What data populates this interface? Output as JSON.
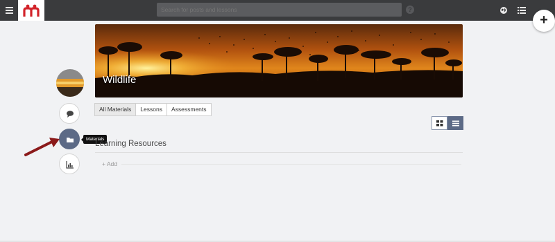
{
  "topbar": {
    "search_placeholder": "Search for posts and lessons",
    "help_label": "?",
    "plus_label": "+"
  },
  "banner": {
    "title": "Wildlife"
  },
  "tooltip": {
    "text": "Materials"
  },
  "tabs": [
    {
      "label": "All Materials",
      "active": true
    },
    {
      "label": "Lessons",
      "active": false
    },
    {
      "label": "Assessments",
      "active": false
    }
  ],
  "section": {
    "title": "Learning Resources",
    "add_label": "+ Add"
  },
  "colors": {
    "topbar": "#3a3b3d",
    "accent": "#5c6a86",
    "logo_red": "#d2232a",
    "arrow": "#8b1a1a"
  },
  "icons": [
    "hamburger-icon",
    "logo-icon",
    "help-icon",
    "globe-icon",
    "list-icon",
    "plus-icon",
    "comment-icon",
    "folder-icon",
    "bar-chart-icon",
    "grid-view-icon",
    "list-view-icon",
    "arrow-icon"
  ]
}
